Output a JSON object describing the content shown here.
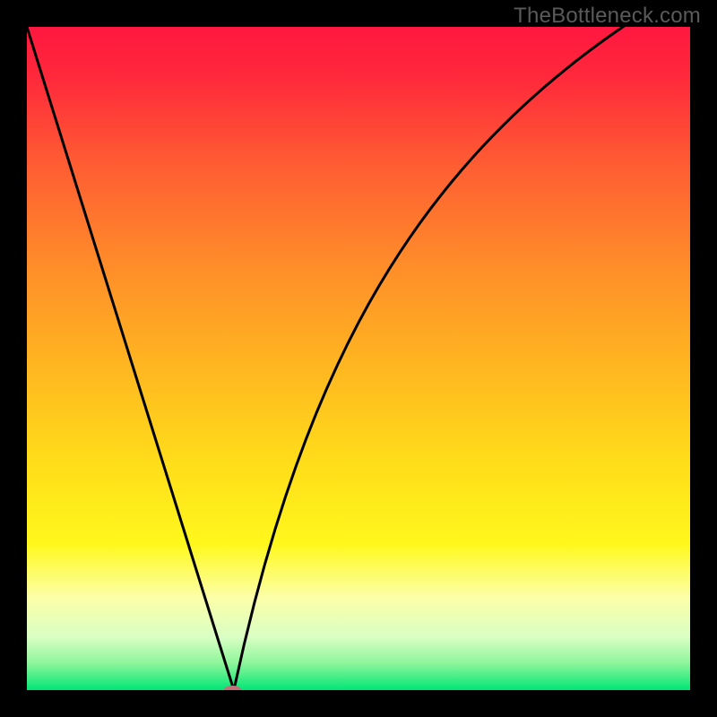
{
  "watermark": "TheBottleneck.com",
  "chart_data": {
    "type": "line",
    "title": "",
    "xlabel": "",
    "ylabel": "",
    "xlim": [
      0,
      100
    ],
    "ylim": [
      0,
      100
    ],
    "grid": false,
    "legend": false,
    "background_gradient_stops": [
      {
        "pos": 0.0,
        "color": "#ff173f"
      },
      {
        "pos": 0.08,
        "color": "#ff2a3b"
      },
      {
        "pos": 0.2,
        "color": "#ff5a33"
      },
      {
        "pos": 0.35,
        "color": "#ff8a2a"
      },
      {
        "pos": 0.5,
        "color": "#ffb321"
      },
      {
        "pos": 0.65,
        "color": "#ffdb1a"
      },
      {
        "pos": 0.78,
        "color": "#fff81c"
      },
      {
        "pos": 0.86,
        "color": "#fcffa8"
      },
      {
        "pos": 0.92,
        "color": "#d9ffc4"
      },
      {
        "pos": 0.96,
        "color": "#8cf59a"
      },
      {
        "pos": 1.0,
        "color": "#00e676"
      }
    ],
    "series": [
      {
        "name": "curve",
        "stroke": "#000000",
        "stroke_width": 3,
        "x": [
          0.0,
          1.56,
          3.12,
          4.68,
          6.24,
          7.8,
          9.36,
          10.92,
          12.48,
          14.04,
          15.6,
          17.16,
          18.72,
          20.28,
          21.84,
          23.4,
          24.96,
          26.52,
          28.08,
          29.64,
          31.2,
          32.76,
          34.32,
          35.88,
          37.44,
          39.0,
          40.56,
          42.12,
          43.68,
          45.24,
          46.8,
          48.36,
          49.92,
          51.48,
          53.04,
          54.6,
          56.16,
          57.72,
          59.28,
          60.84,
          62.4,
          63.96,
          65.52,
          67.08,
          68.64,
          70.2,
          71.76,
          73.32,
          74.88,
          76.44,
          78.0,
          79.56,
          81.12,
          82.68,
          84.24,
          85.8,
          87.36,
          88.92,
          90.48,
          92.04,
          93.6,
          95.16,
          96.72,
          98.28,
          100.0
        ],
        "y": [
          100.0,
          95.0,
          90.0,
          85.0,
          80.0,
          75.0,
          70.0,
          65.0,
          60.0,
          55.0,
          50.0,
          45.0,
          40.0,
          35.0,
          30.0,
          25.0,
          20.0,
          15.0,
          10.0,
          5.0,
          0.0,
          6.92,
          13.23,
          19.0,
          24.3,
          29.19,
          33.72,
          37.93,
          41.86,
          45.53,
          48.97,
          52.21,
          55.26,
          58.14,
          60.86,
          63.44,
          65.89,
          68.22,
          70.44,
          72.56,
          74.58,
          76.52,
          78.38,
          80.16,
          81.87,
          83.52,
          85.1,
          86.63,
          88.1,
          89.52,
          90.89,
          92.22,
          93.5,
          94.75,
          95.95,
          97.12,
          98.26,
          99.36,
          100.43,
          101.47,
          102.48,
          103.47,
          104.43,
          105.36,
          106.37
        ]
      }
    ],
    "marker": {
      "name": "minimum-marker",
      "x": 31.0,
      "y": 0.0,
      "rx": 1.3,
      "ry": 0.7,
      "fill": "#c1707a"
    }
  }
}
